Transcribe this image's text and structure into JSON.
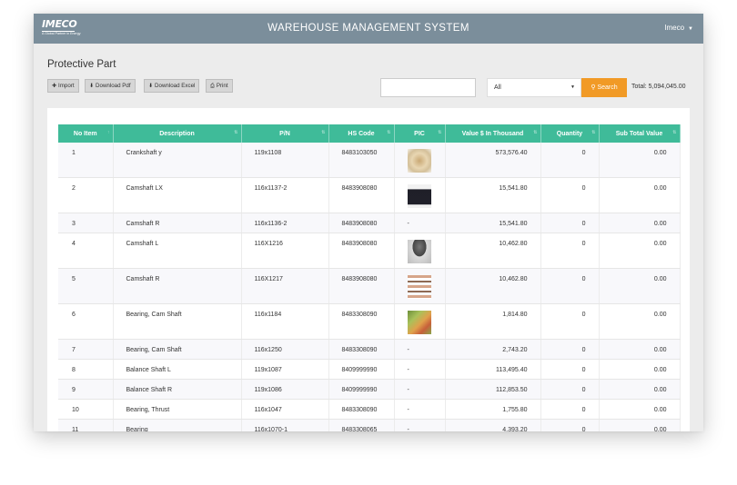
{
  "header": {
    "logo_text": "IMECO",
    "logo_tagline": "A Global Partner in Energy",
    "title": "WAREHOUSE MANAGEMENT SYSTEM",
    "user": "Imeco",
    "user_chevron_icon": "chevron-down-icon"
  },
  "page": {
    "title": "Protective Part"
  },
  "toolbar": {
    "import_label": "Import",
    "download_pdf_label": "Download Pdf",
    "download_excel_label": "Download Excel",
    "print_label": "Print"
  },
  "search": {
    "value": "",
    "placeholder": "",
    "filter_selected": "All",
    "button_label": "Search",
    "total_text": "Total: 5,094,045.00"
  },
  "colors": {
    "header_bar": "#7b8e9b",
    "table_header": "#3fbb99",
    "search_button": "#f19a26"
  },
  "table": {
    "columns": [
      "No Item",
      "Description",
      "P/N",
      "HS Code",
      "PIC",
      "Value $ In Thousand",
      "Quantity",
      "Sub Total Value"
    ],
    "rows": [
      {
        "no": "1",
        "desc": "Crankshaft y",
        "pn": "119x1108",
        "hs": "8483103050",
        "pic": "image",
        "val": "573,576.40",
        "qty": "0",
        "sub": "0.00"
      },
      {
        "no": "2",
        "desc": "Camshaft LX",
        "pn": "116x1137-2",
        "hs": "8483908080",
        "pic": "image",
        "val": "15,541.80",
        "qty": "0",
        "sub": "0.00"
      },
      {
        "no": "3",
        "desc": "Camshaft R",
        "pn": "116x1136-2",
        "hs": "8483908080",
        "pic": "-",
        "val": "15,541.80",
        "qty": "0",
        "sub": "0.00"
      },
      {
        "no": "4",
        "desc": "Camshaft L",
        "pn": "116X1216",
        "hs": "8483908080",
        "pic": "image",
        "val": "10,462.80",
        "qty": "0",
        "sub": "0.00"
      },
      {
        "no": "5",
        "desc": "Camshaft R",
        "pn": "116X1217",
        "hs": "8483908080",
        "pic": "image",
        "val": "10,462.80",
        "qty": "0",
        "sub": "0.00"
      },
      {
        "no": "6",
        "desc": "Bearing, Cam Shaft",
        "pn": "116x1184",
        "hs": "8483308090",
        "pic": "image",
        "val": "1,814.80",
        "qty": "0",
        "sub": "0.00"
      },
      {
        "no": "7",
        "desc": "Bearing, Cam Shaft",
        "pn": "116x1250",
        "hs": "8483308090",
        "pic": "-",
        "val": "2,743.20",
        "qty": "0",
        "sub": "0.00"
      },
      {
        "no": "8",
        "desc": "Balance Shaft L",
        "pn": "119x1087",
        "hs": "8409999990",
        "pic": "-",
        "val": "113,495.40",
        "qty": "0",
        "sub": "0.00"
      },
      {
        "no": "9",
        "desc": "Balance Shaft R",
        "pn": "119x1086",
        "hs": "8409999990",
        "pic": "-",
        "val": "112,853.50",
        "qty": "0",
        "sub": "0.00"
      },
      {
        "no": "10",
        "desc": "Bearing, Thrust",
        "pn": "116x1047",
        "hs": "8483308090",
        "pic": "-",
        "val": "1,755.80",
        "qty": "0",
        "sub": "0.00"
      },
      {
        "no": "11",
        "desc": "Bearing",
        "pn": "116x1070-1",
        "hs": "8483308065",
        "pic": "-",
        "val": "4,393.20",
        "qty": "0",
        "sub": "0.00"
      }
    ]
  }
}
